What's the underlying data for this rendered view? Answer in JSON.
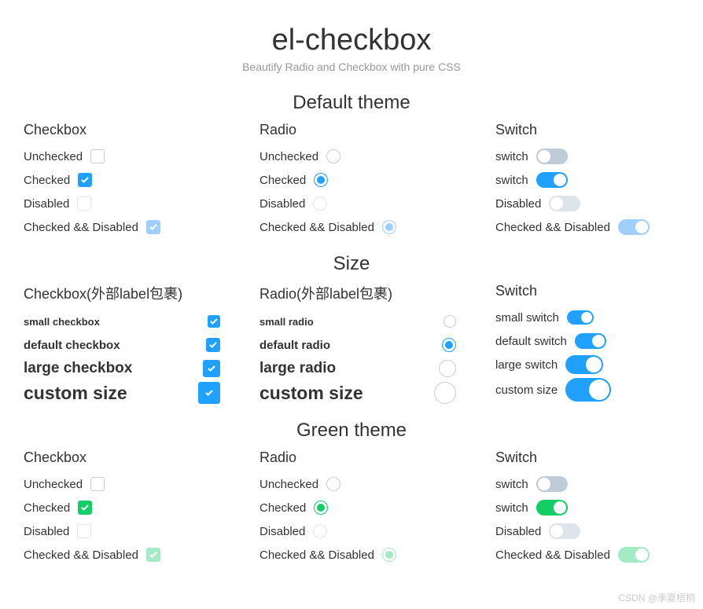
{
  "header": {
    "title": "el-checkbox",
    "subtitle": "Beautify Radio and Checkbox with pure CSS"
  },
  "sections": {
    "default": {
      "title": "Default theme",
      "columns": {
        "checkbox": "Checkbox",
        "radio": "Radio",
        "switch": "Switch"
      },
      "items": {
        "unchecked": "Unchecked",
        "checked": "Checked",
        "disabled": "Disabled",
        "checked_disabled": "Checked && Disabled",
        "switch_off": "switch",
        "switch_on": "switch"
      }
    },
    "size": {
      "title": "Size",
      "columns": {
        "checkbox": "Checkbox(外部label包裹)",
        "radio": "Radio(外部label包裹)",
        "switch": "Switch"
      },
      "items": {
        "cb_small": "small checkbox",
        "cb_default": "default checkbox",
        "cb_large": "large checkbox",
        "cb_custom": "custom size",
        "r_small": "small radio",
        "r_default": "default radio",
        "r_large": "large radio",
        "r_custom": "custom size",
        "s_small": "small switch",
        "s_default": "default switch",
        "s_large": "large switch",
        "s_custom": "custom size"
      }
    },
    "green": {
      "title": "Green theme",
      "columns": {
        "checkbox": "Checkbox",
        "radio": "Radio",
        "switch": "Switch"
      },
      "items": {
        "unchecked": "Unchecked",
        "checked": "Checked",
        "disabled": "Disabled",
        "checked_disabled": "Checked && Disabled",
        "switch_off": "switch",
        "switch_on": "switch"
      }
    }
  },
  "watermark": "CSDN @季夏梧桐"
}
